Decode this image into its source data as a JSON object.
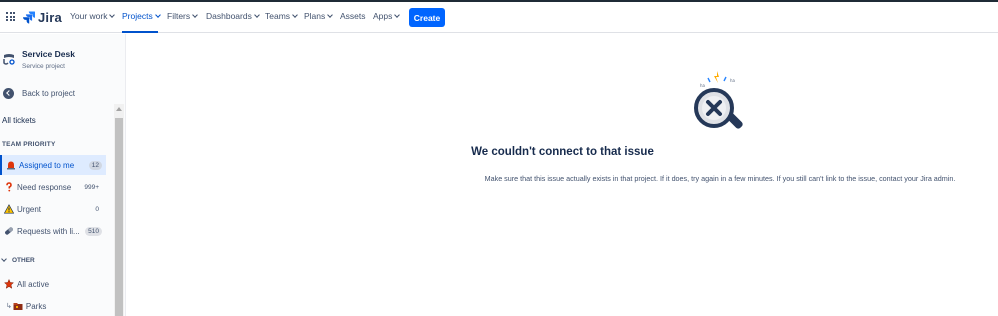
{
  "app": {
    "name": "Jira"
  },
  "nav": {
    "items": [
      {
        "label": "Your work",
        "has_dropdown": true
      },
      {
        "label": "Projects",
        "has_dropdown": true,
        "active": true
      },
      {
        "label": "Filters",
        "has_dropdown": true
      },
      {
        "label": "Dashboards",
        "has_dropdown": true
      },
      {
        "label": "Teams",
        "has_dropdown": true
      },
      {
        "label": "Plans",
        "has_dropdown": true
      },
      {
        "label": "Assets",
        "has_dropdown": false
      },
      {
        "label": "Apps",
        "has_dropdown": true
      }
    ],
    "create_label": "Create"
  },
  "sidebar": {
    "project_name": "Service Desk",
    "project_type": "Service project",
    "back_label": "Back to project",
    "all_tickets_label": "All tickets",
    "team_priority_label": "TEAM PRIORITY",
    "queues": [
      {
        "label": "Assigned to me",
        "count": "12",
        "icon": "alarm-icon",
        "selected": true
      },
      {
        "label": "Need response",
        "count": "999+",
        "icon": "question-icon",
        "selected": false
      },
      {
        "label": "Urgent",
        "count": "0",
        "icon": "warning-icon",
        "selected": false
      },
      {
        "label": "Requests with li...",
        "count": "510",
        "icon": "pill-icon",
        "selected": false
      }
    ],
    "other_label": "OTHER",
    "other_queues": [
      {
        "label": "All active",
        "icon": "star-icon"
      },
      {
        "label": "Parks",
        "icon": "folder-icon"
      }
    ]
  },
  "main": {
    "error_title": "We couldn't connect to that issue",
    "error_body": "Make sure that this issue actually exists in that project. If it does, try again in a few minutes. If you still can't link to the issue, contact your Jira admin."
  },
  "colors": {
    "accent": "#0052cc",
    "create_button": "#0065ff",
    "selected_bg": "#deebff",
    "text_primary": "#172b4d",
    "text_secondary": "#42526e"
  }
}
